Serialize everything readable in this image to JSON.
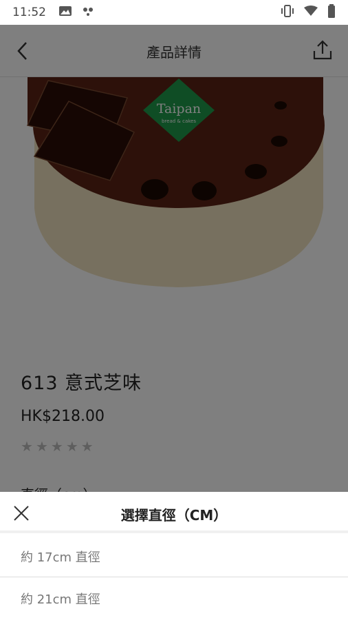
{
  "status_bar": {
    "time": "11:52",
    "left_icons": [
      "image-notification-icon",
      "tape-icon"
    ],
    "right_icons": [
      "vibrate-icon",
      "wifi-icon",
      "battery-icon"
    ]
  },
  "app_bar": {
    "title": "產品詳情",
    "back_icon": "chevron-left-icon",
    "share_icon": "share-icon"
  },
  "product": {
    "image_brand_text": "Taipan",
    "image_brand_sub": "bread & cakes",
    "name": "613 意式芝味",
    "price": "HK$218.00",
    "rating_stars": 5,
    "rating_value": 0,
    "option_label": "直徑（cm）"
  },
  "sheet": {
    "title": "選擇直徑（CM）",
    "options": [
      {
        "label": "約 17cm 直徑"
      },
      {
        "label": "約 21cm 直徑"
      }
    ]
  },
  "colors": {
    "overlay": "#000000",
    "cake_top": "#5a2314",
    "cake_side": "#efe1bf",
    "brand_green": "#1e9a4a",
    "star_empty": "#bdbdbd"
  }
}
